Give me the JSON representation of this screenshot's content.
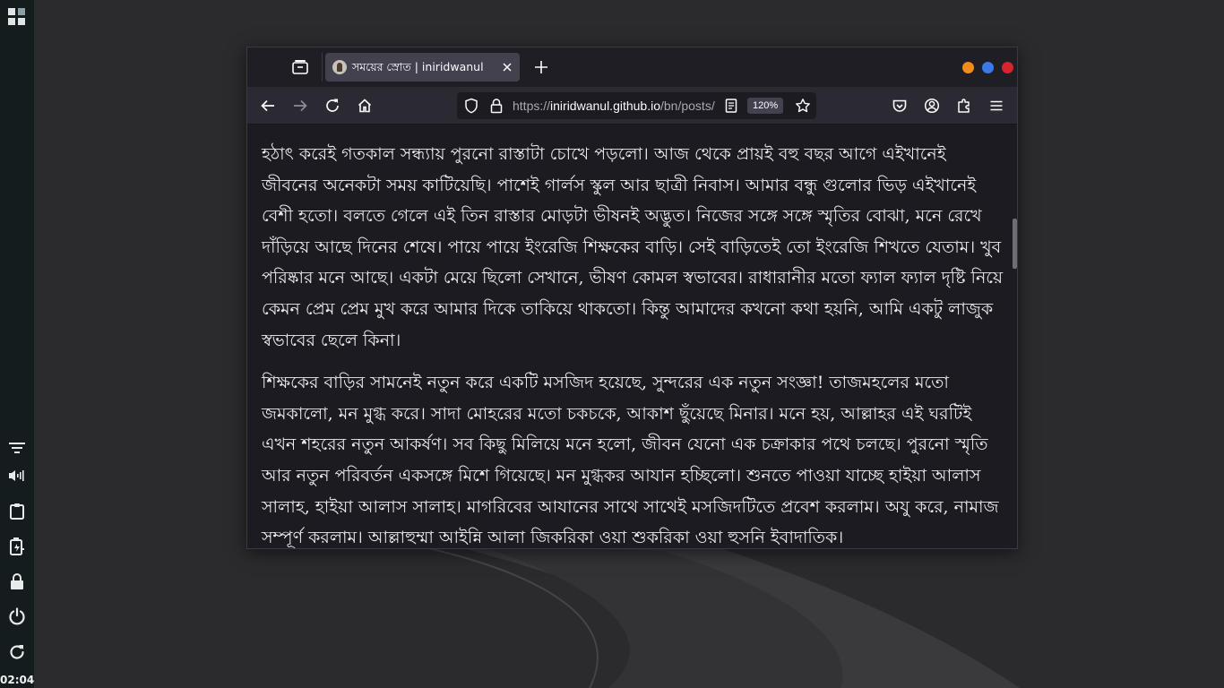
{
  "taskbar": {
    "clock": "02:04",
    "icons": [
      "apps-grid-icon",
      "filter-icon",
      "volume-icon",
      "clipboard-icon",
      "battery-icon",
      "lock-icon",
      "power-icon",
      "restart-icon"
    ]
  },
  "browser": {
    "tab": {
      "title": "সময়ের স্রোত | iniridwanul"
    },
    "url": {
      "prefix": "https://",
      "host": "iniridwanul.github.io",
      "path": "/bn/posts/"
    },
    "zoom": "120%",
    "window_colors": {
      "minimize": "#f08c1a",
      "maximize": "#3b7ae6",
      "close": "#d9232e"
    }
  },
  "article": {
    "paragraphs": [
      "হঠাৎ করেই গতকাল সন্ধ্যায় পুরনো রাস্তাটা চোখে পড়লো। আজ থেকে প্রায়ই বহু বছর আগে এইখানেই জীবনের অনেকটা সময় কাটিয়েছি। পাশেই গার্লস স্কুল আর ছাত্রী নিবাস। আমার বন্ধু গুলোর ভিড় এইখানেই বেশী হতো। বলতে গেলে এই তিন রাস্তার মোড়টা ভীষনই অদ্ভুত। নিজের সঙ্গে সঙ্গে স্মৃতির বোঝা, মনে রেখে দাঁড়িয়ে আছে দিনের শেষে। পায়ে পায়ে ইংরেজি শিক্ষকের বাড়ি। সেই বাড়িতেই তো ইংরেজি শিখতে যেতাম। খুব পরিষ্কার মনে আছে। একটা মেয়ে ছিলো সেখানে, ভীষণ কোমল স্বভাবের। রাধারানীর মতো ফ্যাল ফ্যাল দৃষ্টি নিয়ে কেমন প্রেম প্রেম মুখ করে আমার দিকে তাকিয়ে থাকতো। কিন্তু আমাদের কখনো কথা হয়নি, আমি একটু লাজুক স্বভাবের ছেলে কিনা।",
      "শিক্ষকের বাড়ির সামনেই নতুন করে একটি মসজিদ হয়েছে, সুন্দরের এক নতুন সংজ্ঞা! তাজমহলের মতো জমকালো, মন মুগ্ধ করে। সাদা মোহরের মতো চকচকে, আকাশ ছুঁয়েছে মিনার। মনে হয়, আল্লাহর এই ঘরটিই এখন শহরের নতুন আকর্ষণ। সব কিছু মিলিয়ে মনে হলো, জীবন যেনো এক চক্রাকার পথে চলছে। পুরনো স্মৃতি আর নতুন পরিবর্তন একসঙ্গে মিশে গিয়েছে। মন মুগ্ধকর আযান হচ্ছিলো। শুনতে পাওয়া যাচ্ছে হাইয়া আলাস সালাহ, হাইয়া আলাস সালাহ। মাগরিবের আযানের সাথে সাথেই মসজিদটিতে প্রবেশ করলাম। অযু করে, নামাজ সম্পূর্ণ করলাম। আল্লাহুম্মা আইন্নি আলা জিকরিকা ওয়া শুকরিকা ওয়া হুসনি ইবাদাতিক।"
    ]
  }
}
